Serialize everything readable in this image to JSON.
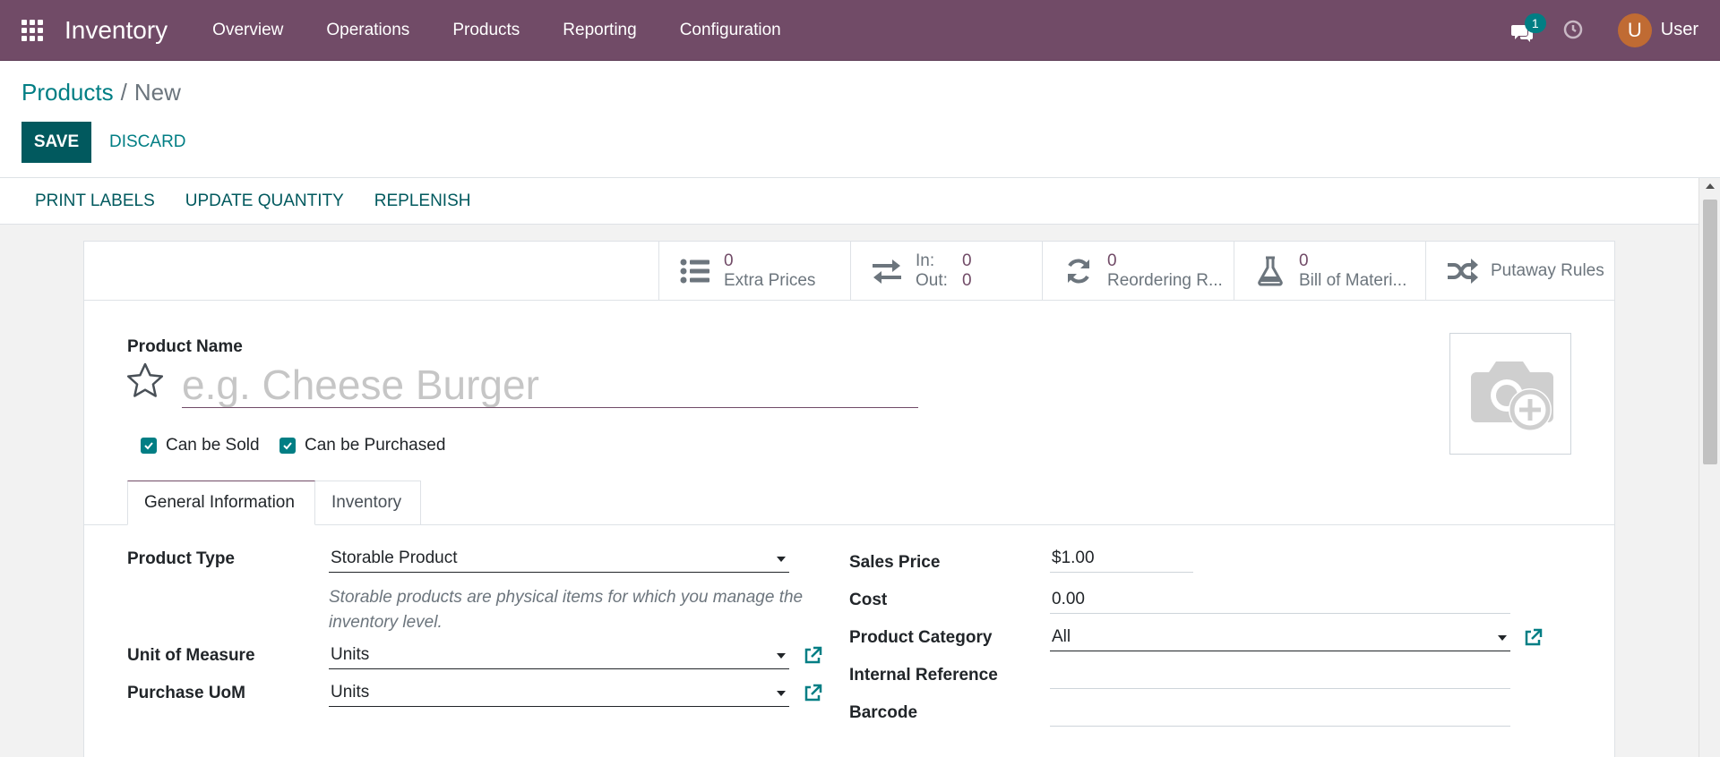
{
  "navbar": {
    "app_title": "Inventory",
    "menu": [
      "Overview",
      "Operations",
      "Products",
      "Reporting",
      "Configuration"
    ],
    "chat_count": "1",
    "user_initial": "U",
    "user_name": "User"
  },
  "breadcrumb": {
    "parent": "Products",
    "separator": "/",
    "current": "New"
  },
  "buttons": {
    "save": "SAVE",
    "discard": "DISCARD"
  },
  "actions": [
    "PRINT LABELS",
    "UPDATE QUANTITY",
    "REPLENISH"
  ],
  "smart_buttons": {
    "extra_prices": {
      "value": "0",
      "label": "Extra Prices",
      "icon": "list-icon"
    },
    "in_out": {
      "in_label": "In:",
      "in_value": "0",
      "out_label": "Out:",
      "out_value": "0",
      "icon": "exchange-icon"
    },
    "reordering": {
      "value": "0",
      "label": "Reordering R...",
      "icon": "refresh-icon"
    },
    "bom": {
      "value": "0",
      "label": "Bill of Materi...",
      "icon": "flask-icon"
    },
    "putaway": {
      "label": "Putaway Rules",
      "icon": "random-icon"
    }
  },
  "form": {
    "product_name_label": "Product Name",
    "product_name_placeholder": "e.g. Cheese Burger",
    "can_be_sold": "Can be Sold",
    "can_be_purchased": "Can be Purchased",
    "tabs": [
      "General Information",
      "Inventory"
    ],
    "product_type_label": "Product Type",
    "product_type_value": "Storable Product",
    "product_type_help": "Storable products are physical items for which you manage the inventory level.",
    "uom_label": "Unit of Measure",
    "uom_value": "Units",
    "purchase_uom_label": "Purchase UoM",
    "purchase_uom_value": "Units",
    "sales_price_label": "Sales Price",
    "sales_price_value": "$1.00",
    "cost_label": "Cost",
    "cost_value": "0.00",
    "category_label": "Product Category",
    "category_value": "All",
    "internal_ref_label": "Internal Reference",
    "internal_ref_value": "",
    "barcode_label": "Barcode",
    "barcode_value": ""
  },
  "colors": {
    "brand": "#714b67",
    "accent": "#017e84",
    "save": "#01595e"
  }
}
